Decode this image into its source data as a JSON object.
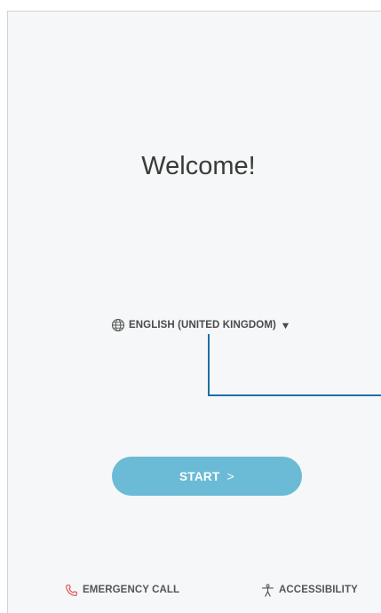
{
  "screen": {
    "title": "Welcome!"
  },
  "language": {
    "selected": "ENGLISH (UNITED KINGDOM)",
    "icon": "globe-icon",
    "dropdown_icon": "dropdown-arrow-icon"
  },
  "start_button": {
    "label": "START",
    "chevron": ">",
    "color": "#6bbad6"
  },
  "footer": {
    "emergency_call": {
      "label": "EMERGENCY CALL",
      "icon": "phone-icon",
      "icon_color": "#e0565b"
    },
    "accessibility": {
      "label": "ACCESSIBILITY",
      "icon": "accessibility-icon"
    }
  },
  "colors": {
    "callout_line": "#1f6fa5",
    "background": "#f6f7f8"
  }
}
